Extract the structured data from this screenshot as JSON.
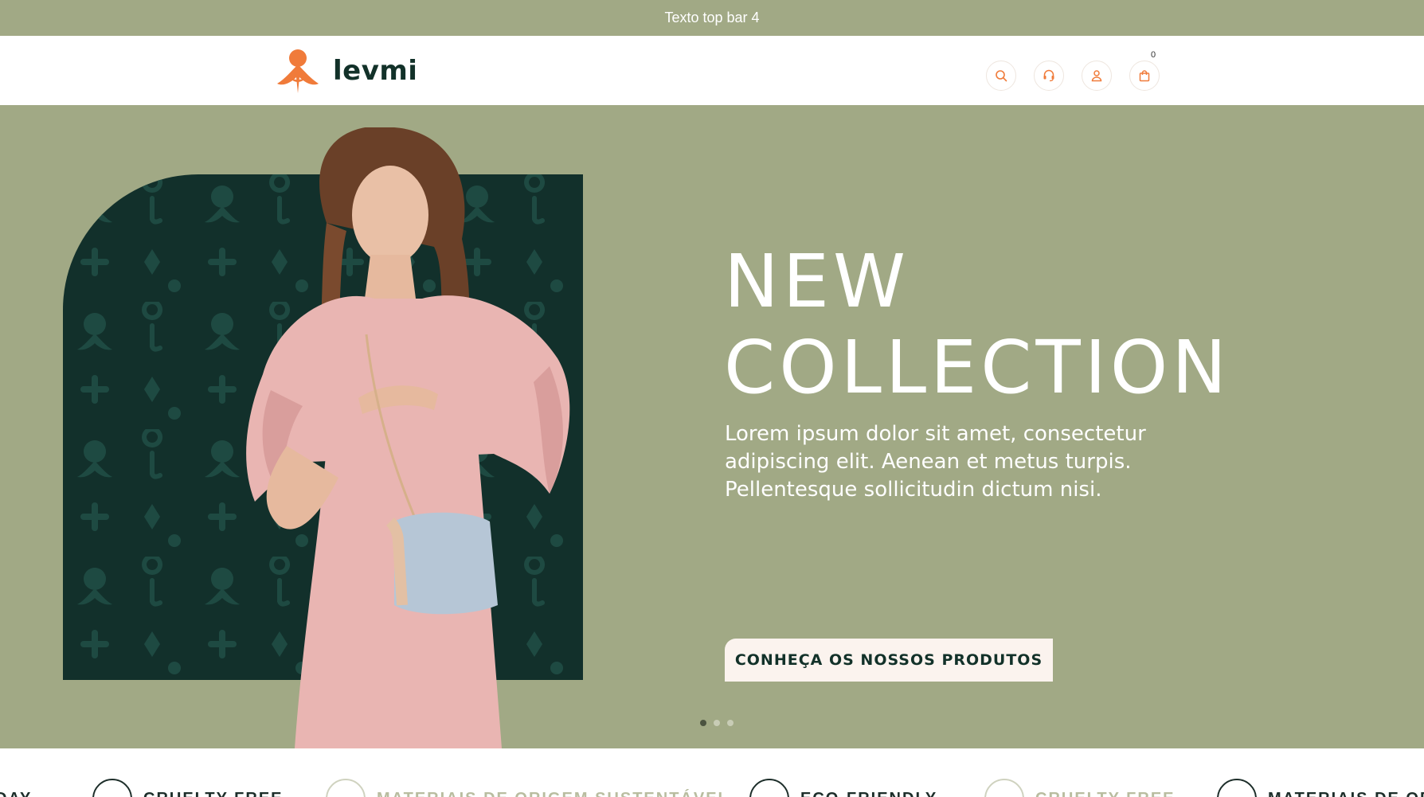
{
  "topbar": {
    "text": "Texto top bar 4"
  },
  "header": {
    "logo_text": "levmi",
    "icons": [
      "search-icon",
      "support-icon",
      "user-icon",
      "bag-icon"
    ],
    "cart_count": "0"
  },
  "hero": {
    "headline_line1": "NEW",
    "headline_line2": "COLLECTION",
    "subtext": "Lorem ipsum dolor sit amet, consectetur adipiscing elit. Aenean et metus turpis. Pellentesque sollicitudin dictum nisi.",
    "cta_label": "CONHEÇA OS NOSSOS PRODUTOS",
    "slides_total": 3,
    "slide_active": 1
  },
  "features": {
    "items": [
      {
        "label": "DAY",
        "style": "dark"
      },
      {
        "label": "CRUELTY FREE",
        "style": "dark"
      },
      {
        "label": "MATERIAIS DE ORIGEM SUSTENTÁVEL",
        "style": "light"
      },
      {
        "label": "ECO-FRIENDLY",
        "style": "dark"
      },
      {
        "label": "CRUELTY FREE",
        "style": "light"
      },
      {
        "label": "MATERIAIS DE ORIGEM",
        "style": "dark"
      }
    ]
  },
  "colors": {
    "sage": "#a1a985",
    "dark_green": "#12302b",
    "brand_orange": "#f07b3a",
    "cta_bg": "#fbf3ee"
  }
}
